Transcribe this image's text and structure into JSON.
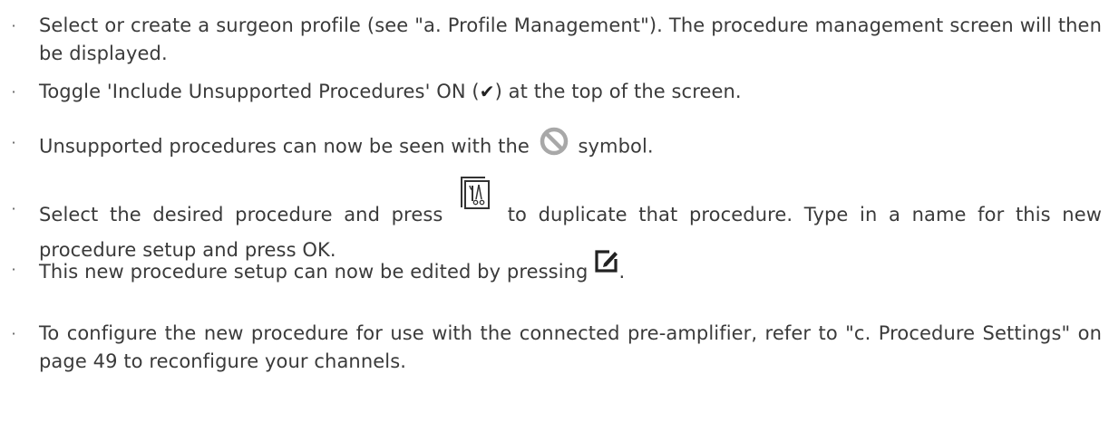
{
  "instructions": {
    "items": [
      {
        "bullet": "·",
        "text": "Select or create a surgeon profile (see \"a. Profile Management\"). The procedure management screen will then be displayed."
      },
      {
        "bullet": "·",
        "text_before": "Toggle 'Include Unsupported Procedures' ON (",
        "check_glyph": "✔",
        "text_after": ") at the top of the screen."
      },
      {
        "bullet": "·",
        "text_before": "Unsupported procedures can now be seen with the",
        "icon": "prohibited-icon",
        "text_after": "symbol."
      },
      {
        "bullet": "·",
        "text_before": "Select the desired procedure and press",
        "icon": "duplicate-procedure-icon",
        "text_after": "to duplicate that procedure. Type in a name for this new procedure setup and press OK."
      },
      {
        "bullet": "·",
        "text_before": "This new procedure setup can now be edited by pressing",
        "icon": "edit-icon",
        "text_after": "."
      },
      {
        "bullet": "·",
        "text": "To configure the new procedure for use with the connected pre-amplifier, refer to \"c. Procedure Settings\" on page 49 to reconfigure your channels."
      }
    ]
  },
  "colors": {
    "text": "#3a3a3a",
    "prohibited_icon": "#a8a8a8",
    "icon_stroke": "#333333"
  }
}
